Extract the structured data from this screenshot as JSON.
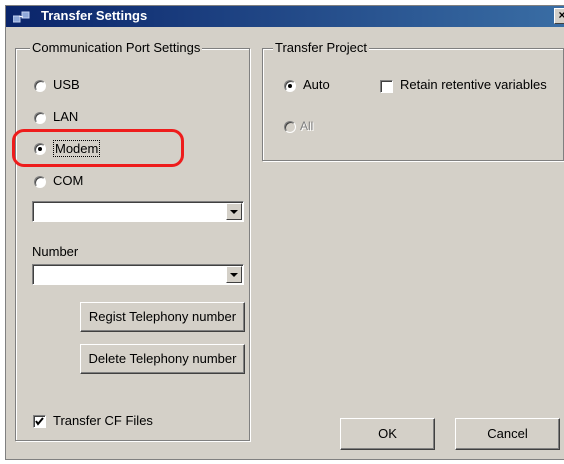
{
  "window": {
    "title": "Transfer Settings",
    "close_label": "×"
  },
  "comm_group": {
    "title": "Communication Port Settings",
    "options": [
      {
        "label": "USB",
        "checked": false
      },
      {
        "label": "LAN",
        "checked": false
      },
      {
        "label": "Modem",
        "checked": true
      },
      {
        "label": "COM",
        "checked": false
      }
    ],
    "port_select_value": "",
    "number_label": "Number",
    "number_select_value": "",
    "regist_button": "Regist Telephony number",
    "delete_button": "Delete Telephony number"
  },
  "project_group": {
    "title": "Transfer Project",
    "auto_label": "Auto",
    "all_label": "All",
    "retain_label": "Retain retentive variables"
  },
  "transfer_cf_label": "Transfer CF Files",
  "ok_button": "OK",
  "cancel_button": "Cancel",
  "colors": {
    "titlebar": "#0a246a",
    "face": "#d4d0c8",
    "highlight": "#ee1c1c"
  }
}
